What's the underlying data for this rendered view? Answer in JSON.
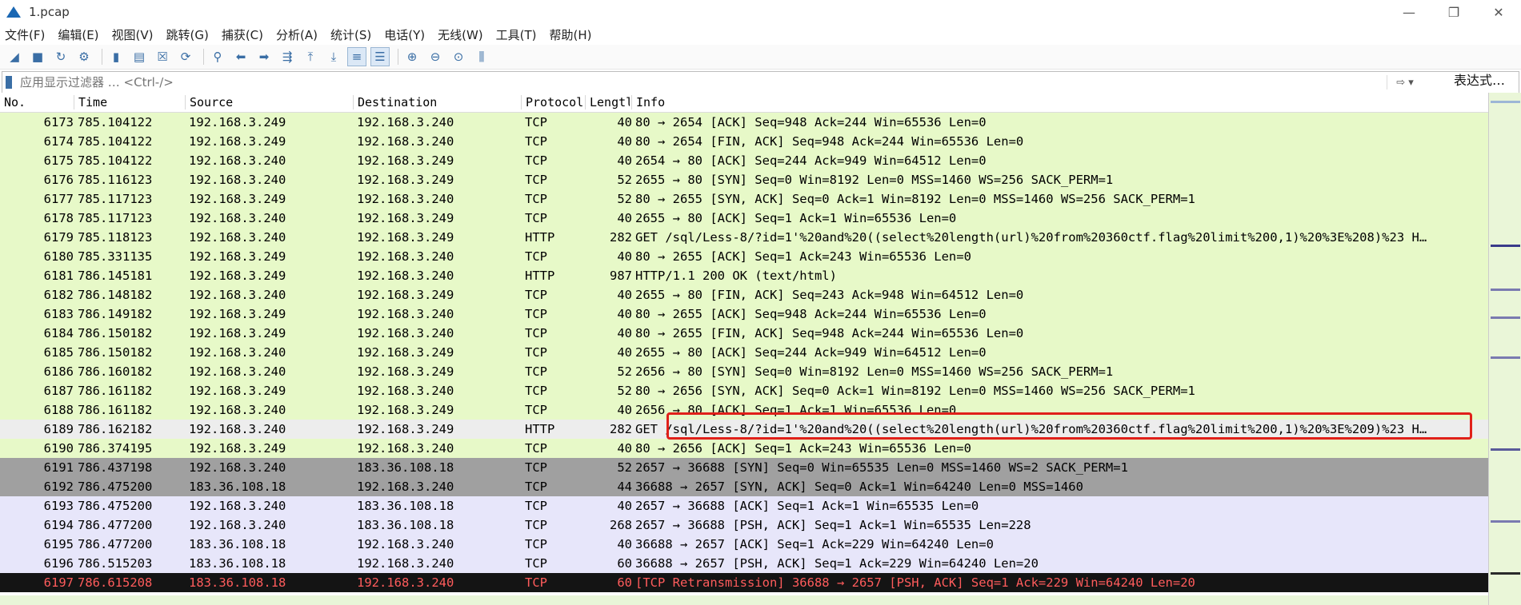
{
  "window": {
    "title": "1.pcap",
    "minimize": "—",
    "maximize": "❐",
    "close": "✕"
  },
  "menu": [
    "文件(F)",
    "编辑(E)",
    "视图(V)",
    "跳转(G)",
    "捕获(C)",
    "分析(A)",
    "统计(S)",
    "电话(Y)",
    "无线(W)",
    "工具(T)",
    "帮助(H)"
  ],
  "filter": {
    "placeholder": "应用显示过滤器 … <Ctrl-/>",
    "expression_label": "表达式…"
  },
  "columns": {
    "no": "No.",
    "time": "Time",
    "source": "Source",
    "destination": "Destination",
    "protocol": "Protocol",
    "length": "Lengtl",
    "info": "Info"
  },
  "colors": {
    "tcp_green": "#e7f9c8",
    "http_green": "#e7f9c8",
    "selected_row": "#ededed",
    "syn_gray": "#a0a0a0",
    "lavender": "#e7e6fa",
    "retrans_black": "#141414",
    "retrans_text": "#ff5c5c",
    "highlight_red": "#e0201a"
  },
  "packets": [
    {
      "no": "6173",
      "time": "785.104122",
      "src": "192.168.3.249",
      "dst": "192.168.3.240",
      "proto": "TCP",
      "len": "40",
      "info": "80 → 2654 [ACK] Seq=948 Ack=244 Win=65536 Len=0",
      "bg": "#e7f9c8",
      "fg": "#000000"
    },
    {
      "no": "6174",
      "time": "785.104122",
      "src": "192.168.3.249",
      "dst": "192.168.3.240",
      "proto": "TCP",
      "len": "40",
      "info": "80 → 2654 [FIN, ACK] Seq=948 Ack=244 Win=65536 Len=0",
      "bg": "#e7f9c8",
      "fg": "#000000"
    },
    {
      "no": "6175",
      "time": "785.104122",
      "src": "192.168.3.240",
      "dst": "192.168.3.249",
      "proto": "TCP",
      "len": "40",
      "info": "2654 → 80 [ACK] Seq=244 Ack=949 Win=64512 Len=0",
      "bg": "#e7f9c8",
      "fg": "#000000"
    },
    {
      "no": "6176",
      "time": "785.116123",
      "src": "192.168.3.240",
      "dst": "192.168.3.249",
      "proto": "TCP",
      "len": "52",
      "info": "2655 → 80 [SYN] Seq=0 Win=8192 Len=0 MSS=1460 WS=256 SACK_PERM=1",
      "bg": "#e7f9c8",
      "fg": "#000000"
    },
    {
      "no": "6177",
      "time": "785.117123",
      "src": "192.168.3.249",
      "dst": "192.168.3.240",
      "proto": "TCP",
      "len": "52",
      "info": "80 → 2655 [SYN, ACK] Seq=0 Ack=1 Win=8192 Len=0 MSS=1460 WS=256 SACK_PERM=1",
      "bg": "#e7f9c8",
      "fg": "#000000"
    },
    {
      "no": "6178",
      "time": "785.117123",
      "src": "192.168.3.240",
      "dst": "192.168.3.249",
      "proto": "TCP",
      "len": "40",
      "info": "2655 → 80 [ACK] Seq=1 Ack=1 Win=65536 Len=0",
      "bg": "#e7f9c8",
      "fg": "#000000"
    },
    {
      "no": "6179",
      "time": "785.118123",
      "src": "192.168.3.240",
      "dst": "192.168.3.249",
      "proto": "HTTP",
      "len": "282",
      "info": "GET /sql/Less-8/?id=1'%20and%20((select%20length(url)%20from%20360ctf.flag%20limit%200,1)%20%3E%208)%23 H…",
      "bg": "#e7f9c8",
      "fg": "#000000"
    },
    {
      "no": "6180",
      "time": "785.331135",
      "src": "192.168.3.249",
      "dst": "192.168.3.240",
      "proto": "TCP",
      "len": "40",
      "info": "80 → 2655 [ACK] Seq=1 Ack=243 Win=65536 Len=0",
      "bg": "#e7f9c8",
      "fg": "#000000"
    },
    {
      "no": "6181",
      "time": "786.145181",
      "src": "192.168.3.249",
      "dst": "192.168.3.240",
      "proto": "HTTP",
      "len": "987",
      "info": "HTTP/1.1 200 OK  (text/html)",
      "bg": "#e7f9c8",
      "fg": "#000000"
    },
    {
      "no": "6182",
      "time": "786.148182",
      "src": "192.168.3.240",
      "dst": "192.168.3.249",
      "proto": "TCP",
      "len": "40",
      "info": "2655 → 80 [FIN, ACK] Seq=243 Ack=948 Win=64512 Len=0",
      "bg": "#e7f9c8",
      "fg": "#000000"
    },
    {
      "no": "6183",
      "time": "786.149182",
      "src": "192.168.3.249",
      "dst": "192.168.3.240",
      "proto": "TCP",
      "len": "40",
      "info": "80 → 2655 [ACK] Seq=948 Ack=244 Win=65536 Len=0",
      "bg": "#e7f9c8",
      "fg": "#000000"
    },
    {
      "no": "6184",
      "time": "786.150182",
      "src": "192.168.3.249",
      "dst": "192.168.3.240",
      "proto": "TCP",
      "len": "40",
      "info": "80 → 2655 [FIN, ACK] Seq=948 Ack=244 Win=65536 Len=0",
      "bg": "#e7f9c8",
      "fg": "#000000"
    },
    {
      "no": "6185",
      "time": "786.150182",
      "src": "192.168.3.240",
      "dst": "192.168.3.249",
      "proto": "TCP",
      "len": "40",
      "info": "2655 → 80 [ACK] Seq=244 Ack=949 Win=64512 Len=0",
      "bg": "#e7f9c8",
      "fg": "#000000"
    },
    {
      "no": "6186",
      "time": "786.160182",
      "src": "192.168.3.240",
      "dst": "192.168.3.249",
      "proto": "TCP",
      "len": "52",
      "info": "2656 → 80 [SYN] Seq=0 Win=8192 Len=0 MSS=1460 WS=256 SACK_PERM=1",
      "bg": "#e7f9c8",
      "fg": "#000000"
    },
    {
      "no": "6187",
      "time": "786.161182",
      "src": "192.168.3.249",
      "dst": "192.168.3.240",
      "proto": "TCP",
      "len": "52",
      "info": "80 → 2656 [SYN, ACK] Seq=0 Ack=1 Win=8192 Len=0 MSS=1460 WS=256 SACK_PERM=1",
      "bg": "#e7f9c8",
      "fg": "#000000"
    },
    {
      "no": "6188",
      "time": "786.161182",
      "src": "192.168.3.240",
      "dst": "192.168.3.249",
      "proto": "TCP",
      "len": "40",
      "info": "2656 → 80 [ACK] Seq=1 Ack=1 Win=65536 Len=0",
      "bg": "#e7f9c8",
      "fg": "#000000"
    },
    {
      "no": "6189",
      "time": "786.162182",
      "src": "192.168.3.240",
      "dst": "192.168.3.249",
      "proto": "HTTP",
      "len": "282",
      "info": "GET /sql/Less-8/?id=1'%20and%20((select%20length(url)%20from%20360ctf.flag%20limit%200,1)%20%3E%209)%23 H…",
      "bg": "#ededed",
      "fg": "#000000"
    },
    {
      "no": "6190",
      "time": "786.374195",
      "src": "192.168.3.249",
      "dst": "192.168.3.240",
      "proto": "TCP",
      "len": "40",
      "info": "80 → 2656 [ACK] Seq=1 Ack=243 Win=65536 Len=0",
      "bg": "#e7f9c8",
      "fg": "#000000"
    },
    {
      "no": "6191",
      "time": "786.437198",
      "src": "192.168.3.240",
      "dst": "183.36.108.18",
      "proto": "TCP",
      "len": "52",
      "info": "2657 → 36688 [SYN] Seq=0 Win=65535 Len=0 MSS=1460 WS=2 SACK_PERM=1",
      "bg": "#a0a0a0",
      "fg": "#000000"
    },
    {
      "no": "6192",
      "time": "786.475200",
      "src": "183.36.108.18",
      "dst": "192.168.3.240",
      "proto": "TCP",
      "len": "44",
      "info": "36688 → 2657 [SYN, ACK] Seq=0 Ack=1 Win=64240 Len=0 MSS=1460",
      "bg": "#a0a0a0",
      "fg": "#000000"
    },
    {
      "no": "6193",
      "time": "786.475200",
      "src": "192.168.3.240",
      "dst": "183.36.108.18",
      "proto": "TCP",
      "len": "40",
      "info": "2657 → 36688 [ACK] Seq=1 Ack=1 Win=65535 Len=0",
      "bg": "#e7e6fa",
      "fg": "#000000"
    },
    {
      "no": "6194",
      "time": "786.477200",
      "src": "192.168.3.240",
      "dst": "183.36.108.18",
      "proto": "TCP",
      "len": "268",
      "info": "2657 → 36688 [PSH, ACK] Seq=1 Ack=1 Win=65535 Len=228",
      "bg": "#e7e6fa",
      "fg": "#000000"
    },
    {
      "no": "6195",
      "time": "786.477200",
      "src": "183.36.108.18",
      "dst": "192.168.3.240",
      "proto": "TCP",
      "len": "40",
      "info": "36688 → 2657 [ACK] Seq=1 Ack=229 Win=64240 Len=0",
      "bg": "#e7e6fa",
      "fg": "#000000"
    },
    {
      "no": "6196",
      "time": "786.515203",
      "src": "183.36.108.18",
      "dst": "192.168.3.240",
      "proto": "TCP",
      "len": "60",
      "info": "36688 → 2657 [PSH, ACK] Seq=1 Ack=229 Win=64240 Len=20",
      "bg": "#e7e6fa",
      "fg": "#000000"
    },
    {
      "no": "6197",
      "time": "786.615208",
      "src": "183.36.108.18",
      "dst": "192.168.3.240",
      "proto": "TCP",
      "len": "60",
      "info": "[TCP Retransmission] 36688 → 2657 [PSH, ACK] Seq=1 Ack=229 Win=64240 Len=20",
      "bg": "#141414",
      "fg": "#ff5c5c"
    }
  ]
}
